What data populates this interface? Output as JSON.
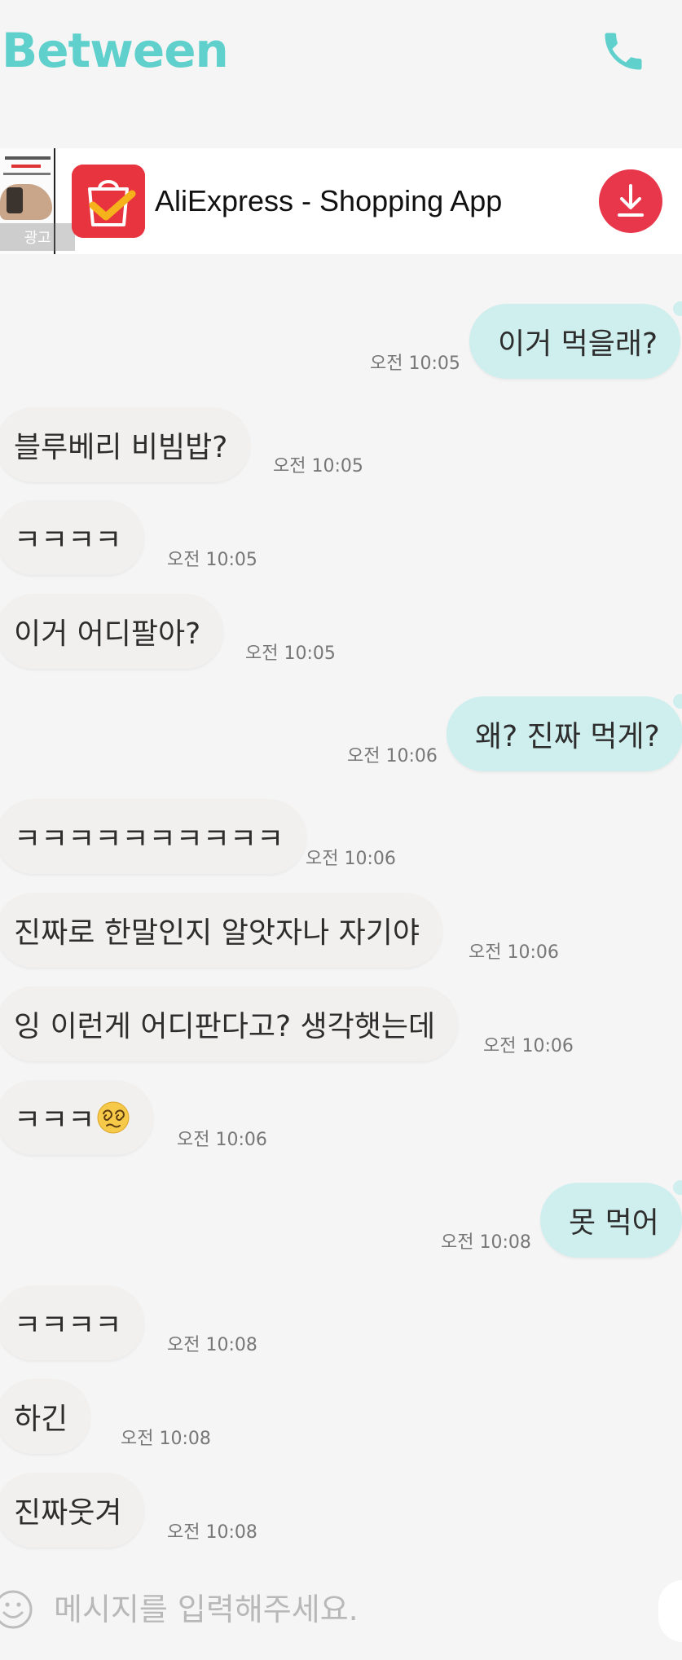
{
  "header": {
    "title": "Between",
    "call_icon": "phone-icon",
    "accent_color": "#5fd0cc"
  },
  "ad": {
    "tag": "광고",
    "app_name": "AliExpress - Shopping App",
    "download_icon": "download-icon",
    "icon": "aliexpress-app-icon"
  },
  "messages": [
    {
      "side": "out",
      "text": "이거 먹을래?",
      "time": "오전 10:05"
    },
    {
      "side": "in",
      "text": "블루베리 비빔밥?",
      "time": "오전 10:05"
    },
    {
      "side": "in",
      "text": "ㅋㅋㅋㅋ",
      "time": "오전 10:05"
    },
    {
      "side": "in",
      "text": "이거 어디팔아?",
      "time": "오전 10:05"
    },
    {
      "side": "out",
      "text": "왜? 진짜 먹게?",
      "time": "오전 10:06"
    },
    {
      "side": "in",
      "text": "ㅋㅋㅋㅋㅋㅋㅋㅋㅋㅋ",
      "time": "오전 10:06"
    },
    {
      "side": "in",
      "text": "진짜로 한말인지 알앗자나 자기야",
      "time": "오전 10:06"
    },
    {
      "side": "in",
      "text": "잉 이런게 어디판다고? 생각햇는데",
      "time": "오전 10:06"
    },
    {
      "side": "in",
      "text": "ㅋㅋㅋ",
      "emoji": "dizzy-face-emoji",
      "time": "오전 10:06"
    },
    {
      "side": "out",
      "text": "못 먹어",
      "time": "오전 10:08"
    },
    {
      "side": "in",
      "text": "ㅋㅋㅋㅋ",
      "time": "오전 10:08"
    },
    {
      "side": "in",
      "text": "하긴",
      "time": "오전 10:08"
    },
    {
      "side": "in",
      "text": "진짜웃겨",
      "time": "오전 10:08"
    }
  ],
  "input": {
    "placeholder": "메시지를 입력해주세요.",
    "emoji_icon": "smile-icon"
  },
  "colors": {
    "incoming_bubble": "#f2f0ee",
    "outgoing_bubble": "#cfeeee",
    "download_red": "#e8364a"
  }
}
